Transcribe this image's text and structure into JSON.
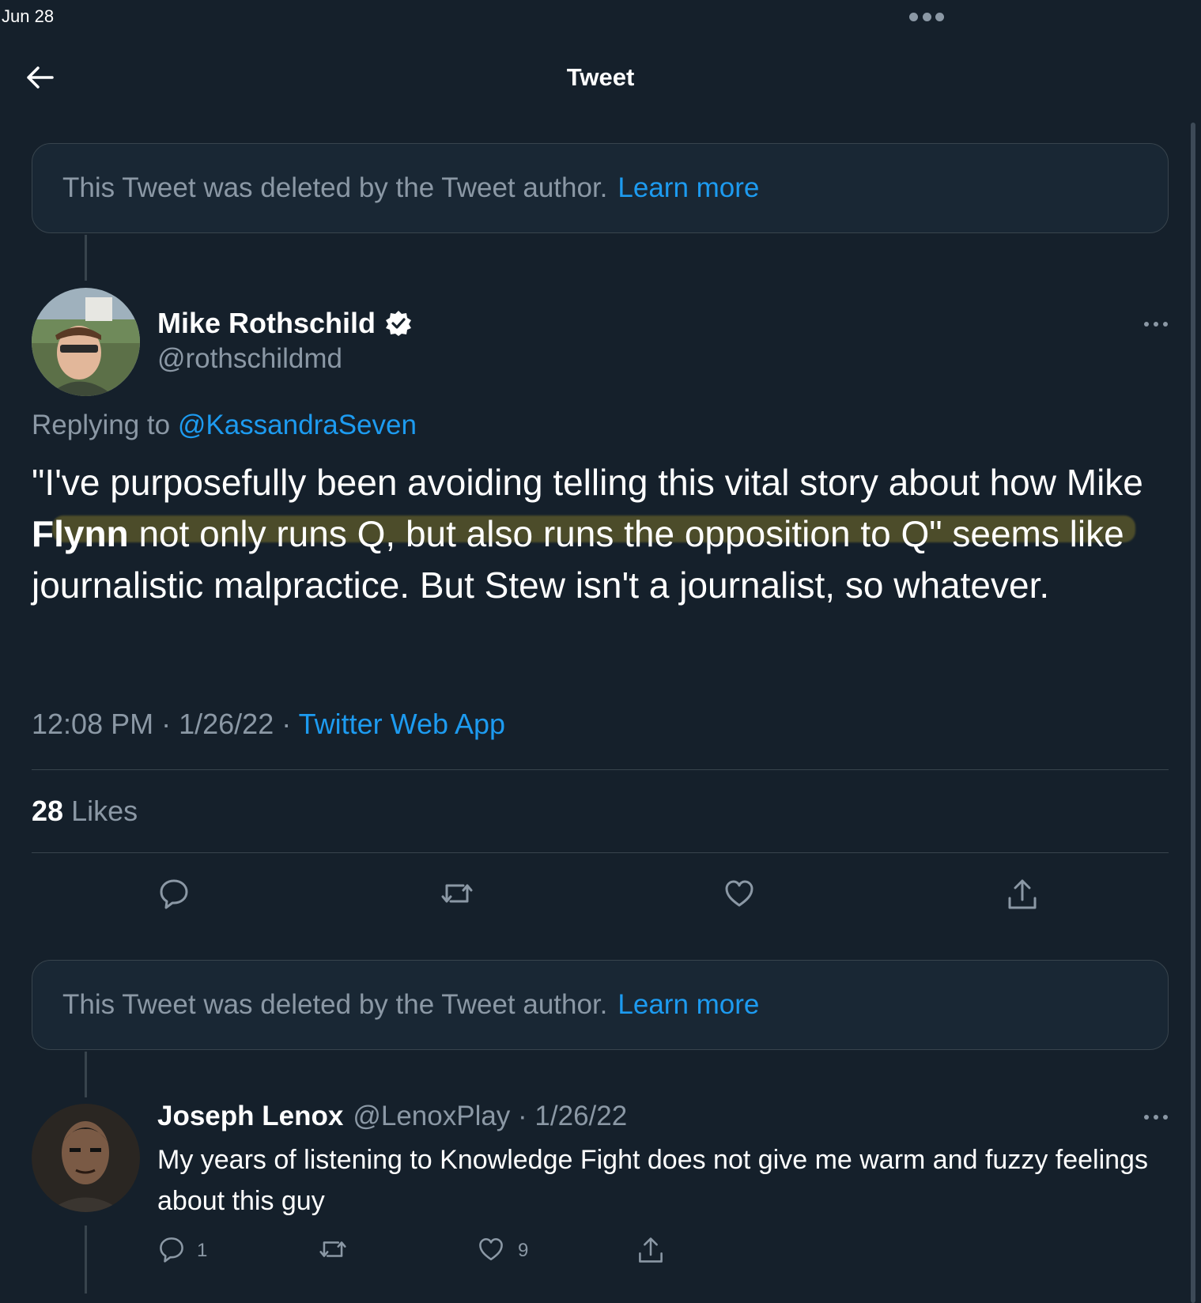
{
  "status_bar": {
    "date": "Jun 28"
  },
  "header": {
    "title": "Tweet"
  },
  "deleted_notice": {
    "text": "This Tweet was deleted by the Tweet author.",
    "link": "Learn more"
  },
  "main_tweet": {
    "display_name": "Mike Rothschild",
    "handle": "@rothschildmd",
    "verified": true,
    "replying_prefix": "Replying to",
    "replying_to": "@KassandraSeven",
    "text_part1": "\"I've purposefully been avoiding telling this vital story about how Mike ",
    "text_bold": "Flynn",
    "text_part2": " not only runs Q, but also runs the opposition to Q\" seems like journalistic malpractice. But Stew isn't a journalist, so whatever.",
    "time": "12:08 PM",
    "date": "1/26/22",
    "source": "Twitter Web App",
    "likes_count": "28",
    "likes_label": "Likes"
  },
  "reply_tweet": {
    "display_name": "Joseph Lenox",
    "handle": "@LenoxPlay",
    "date": "1/26/22",
    "text": "My years of listening to Knowledge Fight does not give me warm and fuzzy feelings about this guy",
    "reply_count": "1",
    "like_count": "9"
  },
  "colors": {
    "background": "#15202b",
    "accent": "#1d9bf0",
    "secondary_text": "#8b98a5",
    "border": "#38444d"
  }
}
